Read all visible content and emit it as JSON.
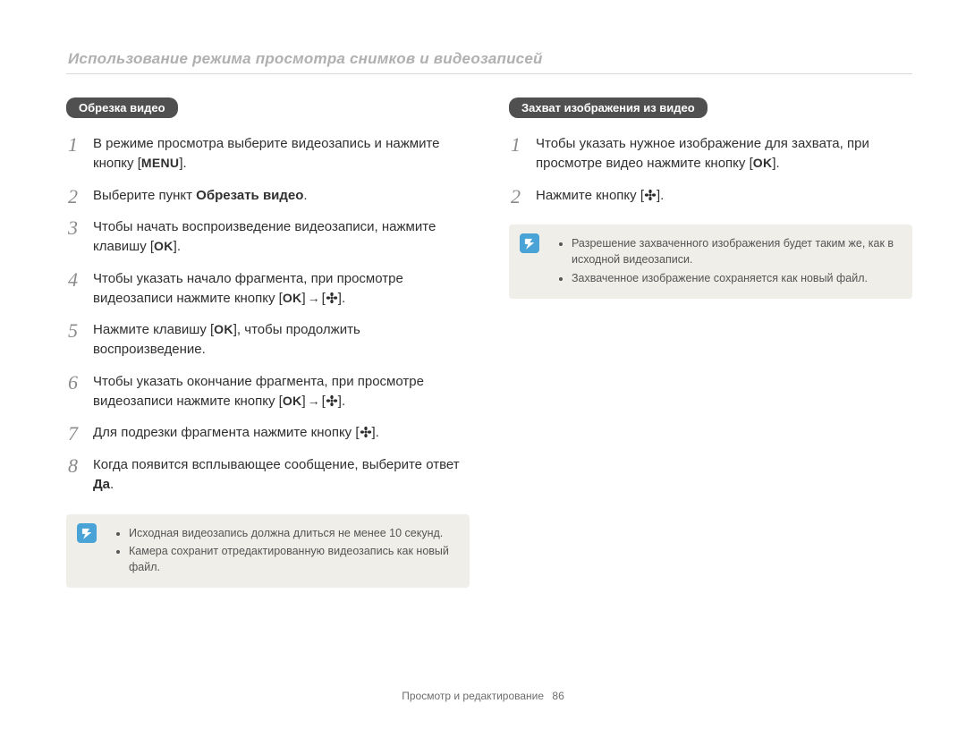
{
  "header": "Использование режима просмотра снимков и видеозаписей",
  "labels": {
    "menu": "MENU",
    "ok": "OK"
  },
  "left": {
    "title": "Обрезка видео",
    "steps": {
      "s1a": "В режиме просмотра выберите видеозапись и нажмите кнопку [",
      "s1b": "].",
      "s2a": "Выберите пункт ",
      "s2bold": "Обрезать видео",
      "s2b": ".",
      "s3a": "Чтобы начать воспроизведение видеозаписи, нажмите клавишу [",
      "s3b": "].",
      "s4a": "Чтобы указать начало фрагмента, при просмотре видеозаписи нажмите кнопку [",
      "s4mid": "] → [",
      "s4b": "].",
      "s5a": "Нажмите клавишу [",
      "s5b": "], чтобы продолжить воспроизведение.",
      "s6a": "Чтобы указать окончание фрагмента, при просмотре видеозаписи нажмите кнопку [",
      "s6mid": "] → [",
      "s6b": "].",
      "s7a": "Для подрезки фрагмента нажмите кнопку [",
      "s7b": "].",
      "s8a": "Когда появится всплывающее сообщение, выберите ответ ",
      "s8bold": "Да",
      "s8b": "."
    },
    "notes": [
      "Исходная видеозапись должна длиться не менее 10 секунд.",
      "Камера сохранит отредактированную видеозапись как новый файл."
    ]
  },
  "right": {
    "title": "Захват изображения из видео",
    "steps": {
      "s1a": "Чтобы указать нужное изображение для захвата, при просмотре видео нажмите кнопку [",
      "s1b": "].",
      "s2a": "Нажмите кнопку [",
      "s2b": "]."
    },
    "notes": [
      "Разрешение захваченного изображения будет таким же, как в исходной видеозаписи.",
      "Захваченное изображение сохраняется как новый файл."
    ]
  },
  "footer": {
    "section": "Просмотр и редактирование",
    "page": "86"
  }
}
